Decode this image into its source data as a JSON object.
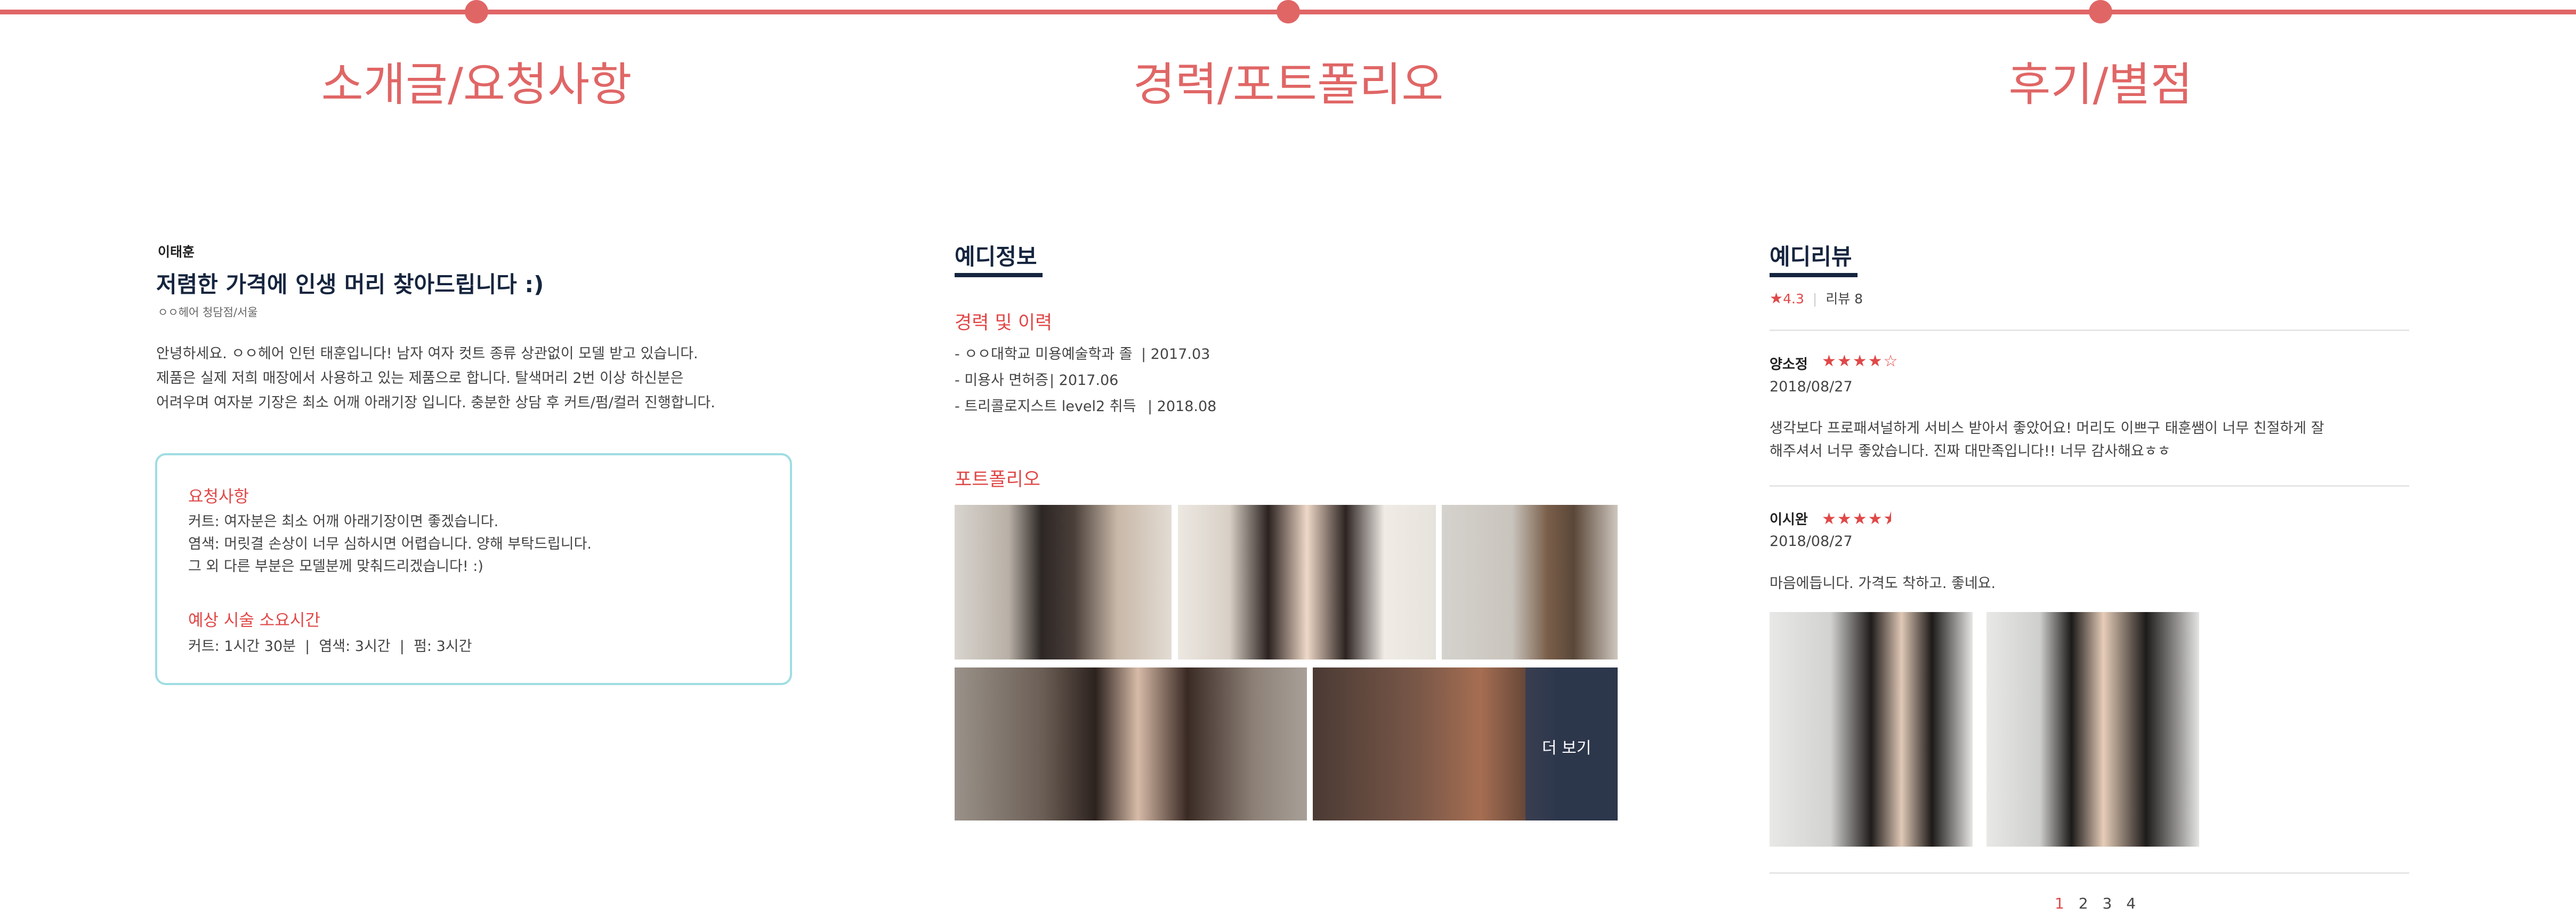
{
  "sections": {
    "intro": "소개글/요청사항",
    "career": "경력/포트폴리오",
    "review": "후기/별점"
  },
  "profile": {
    "name": "이태훈",
    "headline": "저렴한 가격에 인생 머리 찾아드립니다 :)",
    "shop": "ㅇㅇ헤어 청담점/서울",
    "intro_lines": [
      "안녕하세요. ㅇㅇ헤어 인턴 태훈입니다! 남자 여자 컷트 종류 상관없이 모델 받고 있습니다.",
      "제품은 실제 저희 매장에서 사용하고 있는 제품으로 합니다. 탈색머리 2번 이상 하신분은",
      "어려우며 여자분 기장은 최소 어깨 아래기장 입니다. 충분한 상담 후 커트/펌/컬러 진행합니다."
    ]
  },
  "request": {
    "title": "요청사항",
    "lines": [
      "커트: 여자분은 최소 어깨 아래기장이면 좋겠습니다.",
      "염색: 머릿결 손상이 너무 심하시면 어렵습니다. 양해 부탁드립니다.",
      "그 외 다른 부분은 모델분께 맞춰드리겠습니다! :)"
    ],
    "time_title": "예상 시술 소요시간",
    "time_text": "커트: 1시간 30분  |  염색: 3시간  |  펌: 3시간"
  },
  "info": {
    "title": "예디정보",
    "career_title": "경력 및 이력",
    "career": [
      {
        "item": "- ㅇㅇ대학교 미용예술학과 졸",
        "date": "| 2017.03"
      },
      {
        "item": "- 미용사 면허증",
        "date": "| 2017.06"
      },
      {
        "item": "- 트리콜로지스트 level2 취득",
        "date": "| 2018.08"
      }
    ],
    "portfolio_title": "포트폴리오",
    "more_label": "더 보기"
  },
  "reviews": {
    "title": "예디리뷰",
    "rating_icon": "star-icon",
    "rating": "4.3",
    "count_label": "리뷰 8",
    "items": [
      {
        "author": "양소정",
        "stars": 4.0,
        "stars_text": "★★★★☆",
        "date": "2018/08/27",
        "text": [
          "생각보다 프로패셔널하게 서비스 받아서 좋았어요! 머리도 이쁘구 태훈쌤이 너무 친절하게 잘",
          "해주셔서 너무 좋았습니다. 진짜 대만족입니다!! 너무 감사해요ㅎㅎ"
        ]
      },
      {
        "author": "이시완",
        "stars": 4.5,
        "stars_text": "★★★★⯨",
        "date": "2018/08/27",
        "text": [
          "마음에듭니다. 가격도 착하고. 좋네요."
        ]
      }
    ],
    "pages": [
      "1",
      "2",
      "3",
      "4"
    ],
    "current_page": "1"
  },
  "colors": {
    "accent": "#e06666",
    "navy": "#16253f",
    "mint": "#9fdde2",
    "star": "#e04848"
  }
}
